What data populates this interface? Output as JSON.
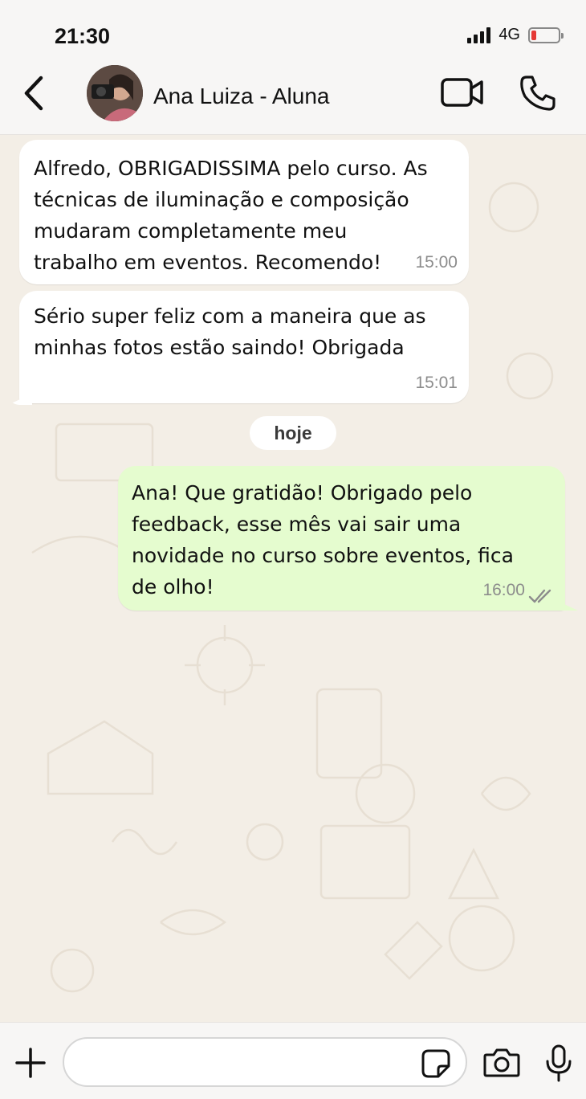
{
  "status_bar": {
    "time": "21:30",
    "network": "4G",
    "battery_color": "#e53935"
  },
  "header": {
    "back_icon": "chevron-left-icon",
    "contact_name": "Ana Luiza - Aluna",
    "video_icon": "video-camera-icon",
    "call_icon": "phone-icon"
  },
  "messages": [
    {
      "direction": "incoming",
      "lines": [
        "Alfredo, OBRIGADISSIMA pelo curso. As",
        "técnicas de iluminação e composição",
        "mudaram completamente meu",
        "trabalho em eventos. Recomendo!"
      ],
      "time": "15:00"
    },
    {
      "direction": "incoming",
      "lines": [
        "Sério super feliz com a maneira que as",
        "minhas fotos estão saindo! Obrigada"
      ],
      "time": "15:01"
    },
    {
      "direction": "outgoing",
      "lines": [
        "Ana! Que gratidão! Obrigado pelo",
        "feedback, esse mês vai sair uma",
        "novidade no curso sobre eventos, fica",
        "de olho!"
      ],
      "time": "16:00",
      "status_icon": "double-check-icon"
    }
  ],
  "date_separator": "hoje",
  "composer": {
    "value": "",
    "placeholder": "",
    "attach_icon": "plus-icon",
    "sticker_icon": "sticker-icon",
    "camera_icon": "camera-icon",
    "mic_icon": "microphone-icon"
  },
  "colors": {
    "incoming_bubble": "#ffffff",
    "outgoing_bubble": "#e5fccf",
    "chat_background": "#f3eee6",
    "tick_color": "#8c8c8c"
  }
}
